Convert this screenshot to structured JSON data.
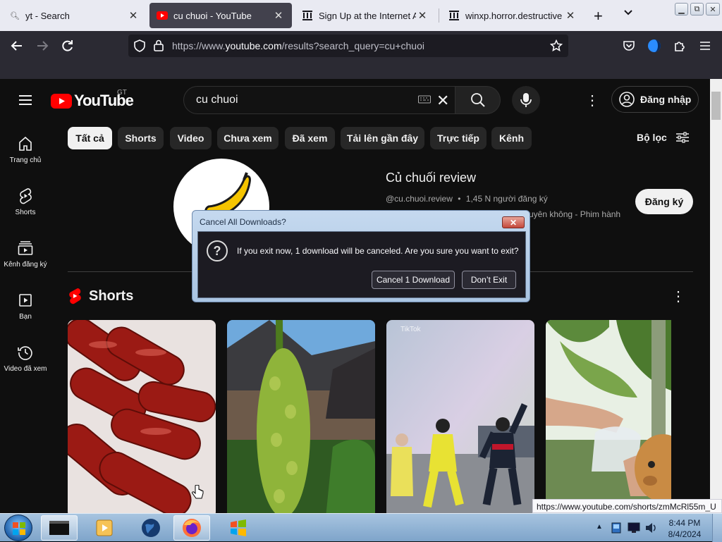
{
  "browser": {
    "tabs": [
      {
        "title": "yt - Search",
        "icon": "search-icon"
      },
      {
        "title": "cu chuoi - YouTube",
        "icon": "youtube-icon"
      },
      {
        "title": "Sign Up at the Internet Archi",
        "icon": "archive-icon"
      },
      {
        "title": "winxp.horror.destructive dire",
        "icon": "archive-icon"
      }
    ],
    "url_prefix": "https://www.",
    "url_domain": "youtube.com",
    "url_rest": "/results?search_query=cu+chuoi"
  },
  "youtube": {
    "logo_text": "YouTube",
    "country_code": "GT",
    "search_value": "cu chuoi",
    "sign_in_label": "Đăng nhập",
    "left_nav": [
      {
        "label": "Trang chủ",
        "icon": "home-icon"
      },
      {
        "label": "Shorts",
        "icon": "shorts-icon"
      },
      {
        "label": "Kênh đăng ký",
        "icon": "subscriptions-icon"
      },
      {
        "label": "Bạn",
        "icon": "you-icon"
      },
      {
        "label": "Video đã xem",
        "icon": "history-icon"
      }
    ],
    "chips": [
      "Tất cả",
      "Shorts",
      "Video",
      "Chưa xem",
      "Đã xem",
      "Tải lên gần đây",
      "Trực tiếp",
      "Kênh"
    ],
    "filters_label": "Bộ lọc",
    "channel": {
      "name": "Củ chuối review",
      "handle": "@cu.chuoi.review",
      "meta_sep": "•",
      "subscribers": "1,45 N người đăng ký",
      "description": "uyên không - Phim hành",
      "subscribe_label": "Đăng ký"
    },
    "shorts_heading": "Shorts",
    "tiktok_label": "TikTok"
  },
  "dialog": {
    "title": "Cancel All Downloads?",
    "message": "If you exit now, 1 download will be canceled. Are you sure you want to exit?",
    "cancel_button": "Cancel 1 Download",
    "dont_exit_button": "Don’t Exit"
  },
  "status_url": "https://www.youtube.com/shorts/zmMcRl55m_U",
  "taskbar": {
    "time": "8:44 PM",
    "date": "8/4/2024"
  },
  "colors": {
    "youtube_red": "#ff0000",
    "page_bg": "#0f0f0f",
    "browser_chrome": "#2b2a33"
  }
}
